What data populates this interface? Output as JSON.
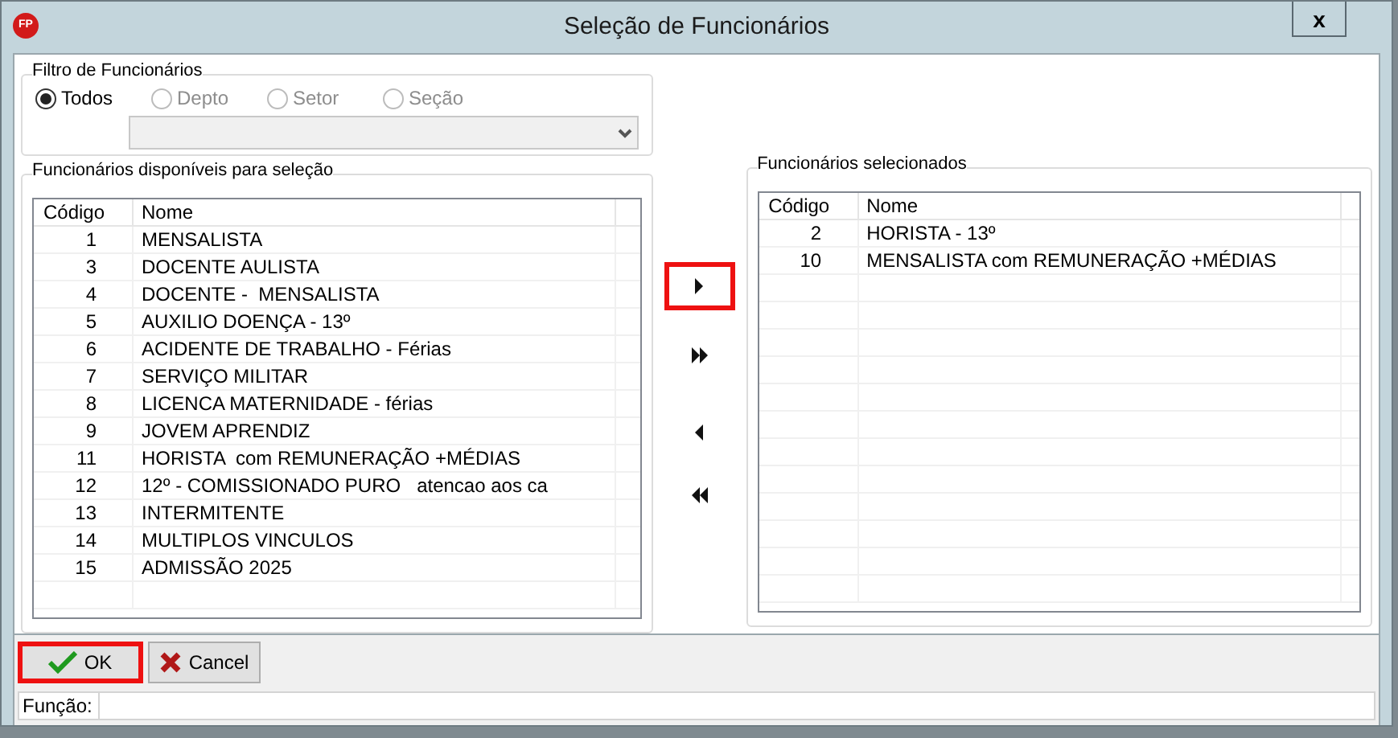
{
  "window": {
    "logo": "FP",
    "title": "Seleção de Funcionários",
    "close": "x"
  },
  "filter": {
    "title": "Filtro de Funcionários",
    "options": [
      {
        "label": "Todos",
        "selected": true,
        "disabled": false
      },
      {
        "label": "Depto",
        "selected": false,
        "disabled": true
      },
      {
        "label": "Setor",
        "selected": false,
        "disabled": true
      },
      {
        "label": "Seção",
        "selected": false,
        "disabled": true
      }
    ],
    "dropdown": {
      "disabled": true
    }
  },
  "available": {
    "title": "Funcionários disponíveis para seleção",
    "columns": [
      "Código",
      "Nome"
    ],
    "rows": [
      [
        "1",
        "MENSALISTA"
      ],
      [
        "3",
        "DOCENTE AULISTA"
      ],
      [
        "4",
        "DOCENTE -  MENSALISTA"
      ],
      [
        "5",
        "AUXILIO DOENÇA - 13º"
      ],
      [
        "6",
        "ACIDENTE DE TRABALHO - Férias"
      ],
      [
        "7",
        "SERVIÇO MILITAR"
      ],
      [
        "8",
        "LICENCA MATERNIDADE - férias"
      ],
      [
        "9",
        "JOVEM APRENDIZ"
      ],
      [
        "11",
        "HORISTA  com REMUNERAÇÃO +MÉDIAS"
      ],
      [
        "12",
        "12º - COMISSIONADO PURO   atencao aos ca"
      ],
      [
        "13",
        "INTERMITENTE"
      ],
      [
        "14",
        "MULTIPLOS VINCULOS"
      ],
      [
        "15",
        "ADMISSÃO 2025"
      ]
    ]
  },
  "transfer_buttons": [
    {
      "kind": "add",
      "highlighted": true
    },
    {
      "kind": "add_all",
      "highlighted": false
    },
    {
      "kind": "remove",
      "highlighted": false
    },
    {
      "kind": "remove_all",
      "highlighted": false
    }
  ],
  "selected": {
    "title": "Funcionários selecionados",
    "columns": [
      "Código",
      "Nome"
    ],
    "rows": [
      [
        "2",
        "HORISTA - 13º"
      ],
      [
        "10",
        "MENSALISTA com REMUNERAÇÃO +MÉDIAS"
      ]
    ]
  },
  "buttons": [
    {
      "kind": "ok",
      "label": "OK",
      "highlighted": true
    },
    {
      "kind": "cancel",
      "label": "Cancel",
      "highlighted": false
    }
  ],
  "status_bar": {
    "label": "Função:"
  }
}
